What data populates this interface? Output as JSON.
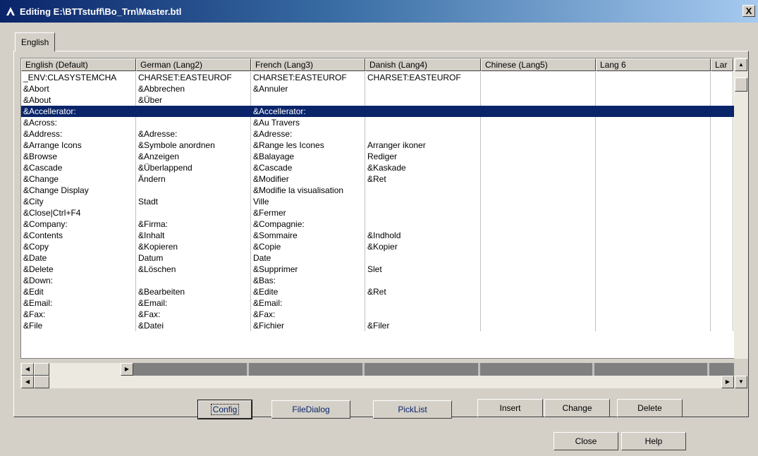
{
  "window": {
    "title": "Editing E:\\BTTstuff\\Bo_Trn\\Master.btl",
    "close_label": "X"
  },
  "tab": {
    "label": "English"
  },
  "grid": {
    "columns": [
      "English (Default)",
      "German (Lang2)",
      "French (Lang3)",
      "Danish (Lang4)",
      "Chinese (Lang5)",
      "Lang 6",
      "Lar"
    ],
    "selected_row": 3,
    "rows": [
      [
        "_ENV:CLASYSTEMCHA",
        "CHARSET:EASTEUROF",
        "CHARSET:EASTEUROF",
        "CHARSET:EASTEUROF",
        "",
        "",
        ""
      ],
      [
        "&Abort",
        "&Abbrechen",
        "&Annuler",
        "",
        "",
        "",
        ""
      ],
      [
        "&About",
        "&Über",
        "",
        "",
        "",
        "",
        ""
      ],
      [
        "&Accellerator:",
        "",
        "&Accellerator:",
        "",
        "",
        "",
        ""
      ],
      [
        "&Across:",
        "",
        "&Au Travers",
        "",
        "",
        "",
        ""
      ],
      [
        "&Address:",
        "&Adresse:",
        "&Adresse:",
        "",
        "",
        "",
        ""
      ],
      [
        "&Arrange Icons",
        "&Symbole anordnen",
        "&Range les Icones",
        "Arranger ikoner",
        "",
        "",
        ""
      ],
      [
        "&Browse",
        "&Anzeigen",
        "&Balayage",
        "Rediger",
        "",
        "",
        ""
      ],
      [
        "&Cascade",
        "&Überlappend",
        "&Cascade",
        "&Kaskade",
        "",
        "",
        ""
      ],
      [
        "&Change",
        "Ändern",
        "&Modifier",
        "&Ret",
        "",
        "",
        ""
      ],
      [
        "&Change Display",
        "",
        "&Modifie la visualisation",
        "",
        "",
        "",
        ""
      ],
      [
        "&City",
        "Stadt",
        "Ville",
        "",
        "",
        "",
        ""
      ],
      [
        "&Close|Ctrl+F4",
        "",
        "&Fermer",
        "",
        "",
        "",
        ""
      ],
      [
        "&Company:",
        "&Firma:",
        "&Compagnie:",
        "",
        "",
        "",
        ""
      ],
      [
        "&Contents",
        "&Inhalt",
        "&Sommaire",
        "&Indhold",
        "",
        "",
        ""
      ],
      [
        "&Copy",
        "&Kopieren",
        "&Copie",
        "&Kopier",
        "",
        "",
        ""
      ],
      [
        "&Date",
        "Datum",
        "Date",
        "",
        "",
        "",
        ""
      ],
      [
        "&Delete",
        "&Löschen",
        "&Supprimer",
        "Slet",
        "",
        "",
        ""
      ],
      [
        "&Down:",
        "",
        "&Bas:",
        "",
        "",
        "",
        ""
      ],
      [
        "&Edit",
        "&Bearbeiten",
        "&Edite",
        "&Ret",
        "",
        "",
        ""
      ],
      [
        "&Email:",
        "&Email:",
        "&Email:",
        "",
        "",
        "",
        ""
      ],
      [
        "&Fax:",
        "&Fax:",
        "&Fax:",
        "",
        "",
        "",
        ""
      ],
      [
        "&File",
        "&Datei",
        "&Fichier",
        "&Filer",
        "",
        "",
        ""
      ]
    ]
  },
  "buttons": {
    "config": "Config",
    "filedialog": "FileDialog",
    "picklist": "PickList",
    "insert": "Insert",
    "change": "Change",
    "delete": "Delete",
    "close": "Close",
    "help": "Help"
  },
  "icons": {
    "app": "app-icon",
    "scroll_up": "scroll-up-arrow-icon",
    "scroll_down": "scroll-down-arrow-icon",
    "scroll_left": "scroll-left-arrow-icon",
    "scroll_right": "scroll-right-arrow-icon"
  },
  "colors": {
    "title_start": "#0a246a",
    "title_end": "#a6caf0",
    "selection": "#0a246a",
    "face": "#d4d0c8"
  }
}
